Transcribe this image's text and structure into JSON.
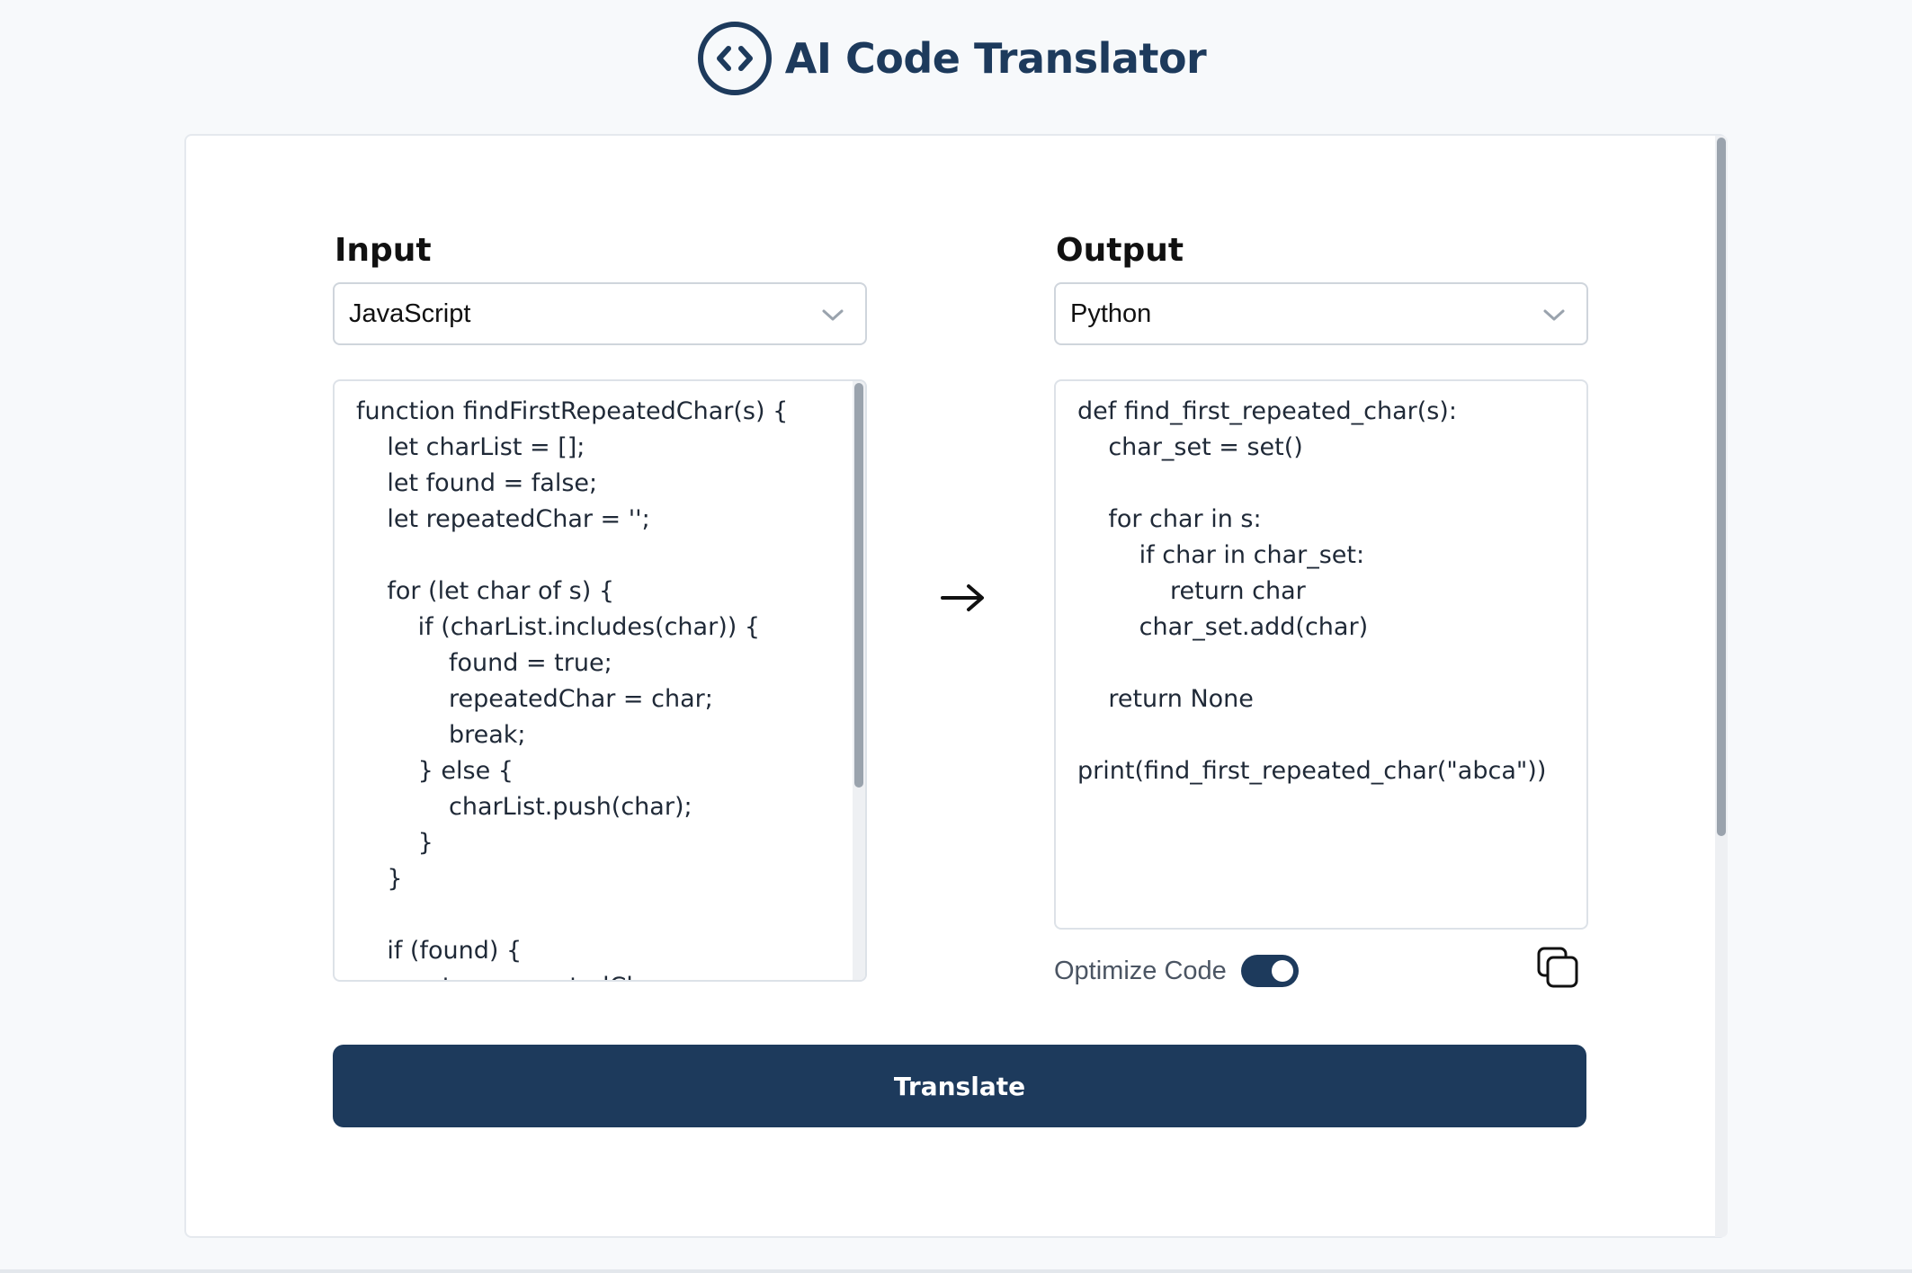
{
  "header": {
    "title": "AI Code Translator",
    "logo_icon": "code-brackets-icon"
  },
  "input": {
    "label": "Input",
    "language": "JavaScript",
    "code": "function findFirstRepeatedChar(s) {\n    let charList = [];\n    let found = false;\n    let repeatedChar = '';\n\n    for (let char of s) {\n        if (charList.includes(char)) {\n            found = true;\n            repeatedChar = char;\n            break;\n        } else {\n            charList.push(char);\n        }\n    }\n\n    if (found) {\n        return repeatedChar;"
  },
  "output": {
    "label": "Output",
    "language": "Python",
    "code": "def find_first_repeated_char(s):\n    char_set = set()\n\n    for char in s:\n        if char in char_set:\n            return char\n        char_set.add(char)\n\n    return None\n\nprint(find_first_repeated_char(\"abca\"))"
  },
  "options": {
    "optimize_label": "Optimize Code",
    "optimize_enabled": true
  },
  "actions": {
    "translate_label": "Translate",
    "copy_icon": "copy-icon",
    "arrow_icon": "arrow-right-icon"
  },
  "colors": {
    "brand": "#1d3a5c",
    "background": "#f7f9fb"
  }
}
